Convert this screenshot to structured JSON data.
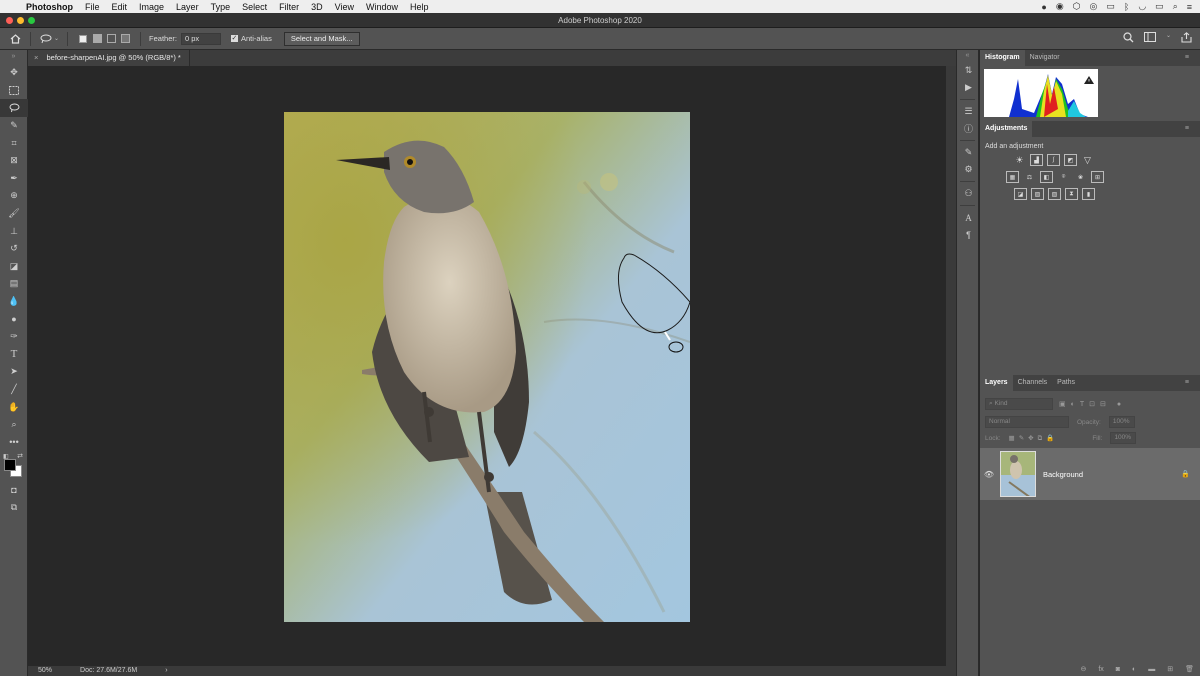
{
  "menubar": {
    "apple": "",
    "items": [
      "Photoshop",
      "File",
      "Edit",
      "Image",
      "Layer",
      "Type",
      "Select",
      "Filter",
      "3D",
      "View",
      "Window",
      "Help"
    ]
  },
  "window": {
    "title": "Adobe Photoshop 2020"
  },
  "options": {
    "feather_label": "Feather:",
    "feather_value": "0 px",
    "antialias_label": "Anti-alias",
    "antialias_checked": true,
    "select_mask_label": "Select and Mask..."
  },
  "document": {
    "tab_title": "before-sharpenAI.jpg @ 50% (RGB/8*) *",
    "close_glyph": "×"
  },
  "status": {
    "zoom": "50%",
    "doc": "Doc: 27.6M/27.6M",
    "arrow": "›"
  },
  "panels": {
    "top_tabs": [
      "Histogram",
      "Navigator"
    ],
    "adjustments_title": "Adjustments",
    "adjustments_hint": "Add an adjustment",
    "layers_tabs": [
      "Layers",
      "Channels",
      "Paths"
    ],
    "kind_placeholder": "Kind",
    "blend_mode": "Normal",
    "opacity_label": "Opacity:",
    "opacity_value": "100%",
    "lock_label": "Lock:",
    "fill_label": "Fill:",
    "fill_value": "100%",
    "layer_name": "Background"
  },
  "colors": {
    "panel_bg": "#535353",
    "canvas_bg": "#282828",
    "menubar_bg": "#eeeeee"
  }
}
